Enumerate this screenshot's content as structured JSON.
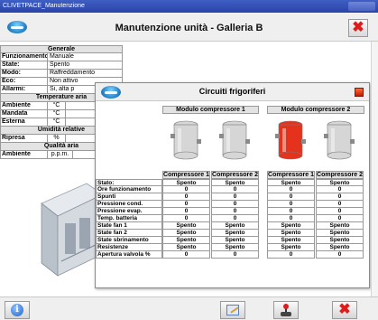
{
  "window": {
    "title": "CLIVETPACE_Manutenzione"
  },
  "header": {
    "title": "Manutenzione unità - Galleria B"
  },
  "left_panel": {
    "generale": {
      "title": "Generale",
      "rows": [
        {
          "label": "Funzionamento:",
          "value": "Manuale"
        },
        {
          "label": "State:",
          "value": "Spento"
        },
        {
          "label": "Modo:",
          "value": "Raffreddamento"
        },
        {
          "label": "Eco:",
          "value": "Non attivo"
        },
        {
          "label": "Allarmi:",
          "value": "Si, alta p"
        }
      ]
    },
    "temperature": {
      "title": "Temperature aria",
      "rows": [
        {
          "label": "Ambiente",
          "unit": "°C"
        },
        {
          "label": "Mandata",
          "unit": "°C"
        },
        {
          "label": "Esterna",
          "unit": "°C"
        }
      ]
    },
    "umidita": {
      "title": "Umidità relative",
      "rows": [
        {
          "label": "Ripresa",
          "unit": "%"
        }
      ]
    },
    "qualita": {
      "title": "Qualità aria",
      "rows": [
        {
          "label": "Ambiente",
          "unit": "p.p.m."
        }
      ]
    }
  },
  "dialog": {
    "title": "Circuiti frigoriferi",
    "modules": [
      "Modulo compressore 1",
      "Modulo compressore 2"
    ],
    "columns": [
      "Compressore 1",
      "Compressore 2",
      "Compressore 1",
      "Compressore 2"
    ],
    "compressor_colors": [
      "#d6d6d6",
      "#d6d6d6",
      "#e5321c",
      "#d6d6d6"
    ],
    "rows": [
      {
        "label": "Stato:",
        "values": [
          "Spento",
          "Spento",
          "Spento",
          "Spento"
        ]
      },
      {
        "label": "Ore funzionamento",
        "values": [
          "0",
          "0",
          "0",
          "0"
        ]
      },
      {
        "label": "Spunti",
        "values": [
          "0",
          "0",
          "0",
          "0"
        ]
      },
      {
        "label": "Pressione cond.",
        "values": [
          "0",
          "0",
          "0",
          "0"
        ]
      },
      {
        "label": "Pressione evap.",
        "values": [
          "0",
          "0",
          "0",
          "0"
        ]
      },
      {
        "label": "Temp. batteria",
        "values": [
          "0",
          "0",
          "0",
          "0"
        ]
      },
      {
        "label": "State fan 1",
        "values": [
          "Spento",
          "Spento",
          "Spento",
          "Spento"
        ]
      },
      {
        "label": "State fan 2",
        "values": [
          "Spento",
          "Spento",
          "Spento",
          "Spento"
        ]
      },
      {
        "label": "State sbrinamento",
        "values": [
          "Spento",
          "Spento",
          "Spento",
          "Spento"
        ]
      },
      {
        "label": "Resistenze",
        "values": [
          "Spento",
          "Spento",
          "Spento",
          "Spento"
        ]
      },
      {
        "label": "Apertura valvola %",
        "values": [
          "0",
          "0",
          "0",
          "0"
        ]
      }
    ]
  },
  "footer": {
    "buttons": [
      {
        "name": "info-button",
        "icon": "info-icon"
      },
      {
        "name": "edit-button",
        "icon": "edit-icon"
      },
      {
        "name": "manual-control-button",
        "icon": "joystick-icon"
      },
      {
        "name": "close-button",
        "icon": "close-icon"
      }
    ]
  },
  "colors": {
    "alarm_compressor": "#e5321c",
    "close_red": "#e01b1b",
    "header_gray": "#efefef"
  }
}
